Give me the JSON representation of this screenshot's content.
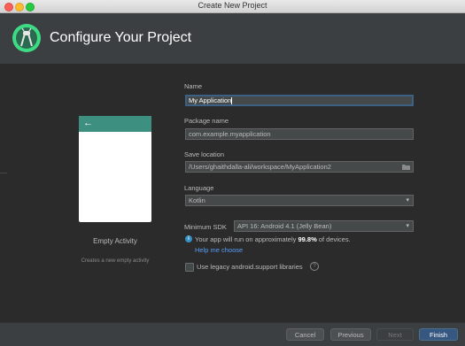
{
  "window": {
    "title": "Create New Project"
  },
  "header": {
    "title": "Configure Your Project"
  },
  "template": {
    "name": "Empty Activity",
    "description": "Creates a new empty activity"
  },
  "form": {
    "name": {
      "label": "Name",
      "value": "My Application"
    },
    "package": {
      "label": "Package name",
      "value": "com.example.myapplication"
    },
    "save_location": {
      "label": "Save location",
      "value": "/Users/ghaithdalla-ali/workspace/MyApplication2"
    },
    "language": {
      "label": "Language",
      "value": "Kotlin"
    },
    "min_sdk": {
      "label": "Minimum SDK",
      "value": "API 16: Android 4.1 (Jelly Bean)"
    },
    "info": {
      "prefix": "Your app will run on approximately ",
      "percent": "99.8%",
      "suffix": " of devices."
    },
    "help_link": "Help me choose",
    "legacy_checkbox": {
      "label": "Use legacy android.support libraries",
      "checked": false
    }
  },
  "footer": {
    "cancel": "Cancel",
    "previous": "Previous",
    "next": "Next",
    "finish": "Finish"
  },
  "colors": {
    "accent": "#3d8f7f",
    "primary_button": "#365880",
    "link": "#589df6"
  }
}
